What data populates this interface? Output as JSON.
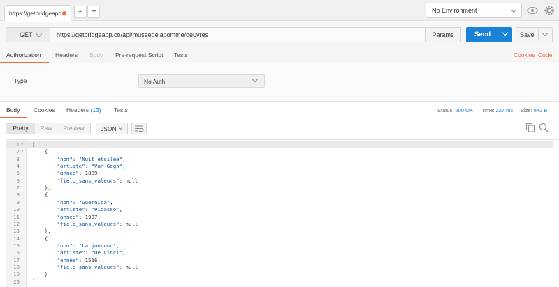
{
  "top_tab": {
    "title": "https://getbridgeapp.c",
    "add": "+",
    "more": "•••"
  },
  "environment": {
    "selected": "No Environment"
  },
  "request": {
    "method": "GET",
    "url": "https://getbridgeapp.co/api/museedelapomme/oeuvres",
    "params_label": "Params",
    "send_label": "Send",
    "save_label": "Save"
  },
  "request_tabs": {
    "authorization": "Authorization",
    "headers": "Headers",
    "body": "Body",
    "prerequest": "Pre-request Script",
    "tests": "Tests",
    "cookies": "Cookies",
    "code": "Code"
  },
  "auth": {
    "type_label": "Type",
    "type_value": "No Auth"
  },
  "response_tabs": {
    "body": "Body",
    "cookies": "Cookies",
    "headers": "Headers",
    "headers_count": "(13)",
    "tests": "Tests"
  },
  "response_meta": {
    "status_label": "Status:",
    "status_value": "200 OK",
    "time_label": "Time:",
    "time_value": "227 ms",
    "size_label": "Size:",
    "size_value": "642 B"
  },
  "response_toolbar": {
    "pretty": "Pretty",
    "raw": "Raw",
    "preview": "Preview",
    "format": "JSON"
  },
  "code_lines": [
    {
      "n": "1",
      "fold": "▾",
      "text": "["
    },
    {
      "n": "2",
      "fold": "▾",
      "text": "    {"
    },
    {
      "n": "3",
      "fold": "",
      "text": "        \"nom\": \"Nuit étoilée\","
    },
    {
      "n": "4",
      "fold": "",
      "text": "        \"artiste\": \"Van Gogh\","
    },
    {
      "n": "5",
      "fold": "",
      "text": "        \"annee\": 1889,"
    },
    {
      "n": "6",
      "fold": "",
      "text": "        \"field_sans_valeurs\": null"
    },
    {
      "n": "7",
      "fold": "",
      "text": "    },"
    },
    {
      "n": "8",
      "fold": "▾",
      "text": "    {"
    },
    {
      "n": "9",
      "fold": "",
      "text": "        \"nom\": \"Guernica\","
    },
    {
      "n": "10",
      "fold": "",
      "text": "        \"artiste\": \"Picasso\","
    },
    {
      "n": "11",
      "fold": "",
      "text": "        \"annee\": 1937,"
    },
    {
      "n": "12",
      "fold": "",
      "text": "        \"field_sans_valeurs\": null"
    },
    {
      "n": "13",
      "fold": "",
      "text": "    },"
    },
    {
      "n": "14",
      "fold": "▾",
      "text": "    {"
    },
    {
      "n": "15",
      "fold": "",
      "text": "        \"nom\": \"La joncond\","
    },
    {
      "n": "16",
      "fold": "",
      "text": "        \"artiste\": \"De Vinci\","
    },
    {
      "n": "17",
      "fold": "",
      "text": "        \"annee\": 1516,"
    },
    {
      "n": "18",
      "fold": "",
      "text": "        \"field_sans_valeurs\": null"
    },
    {
      "n": "19",
      "fold": "",
      "text": "    }"
    },
    {
      "n": "20",
      "fold": "",
      "text": "]"
    }
  ],
  "colors": {
    "accent": "#f26b3a",
    "send": "#1a83d8",
    "link_blue": "#1a83d8"
  }
}
